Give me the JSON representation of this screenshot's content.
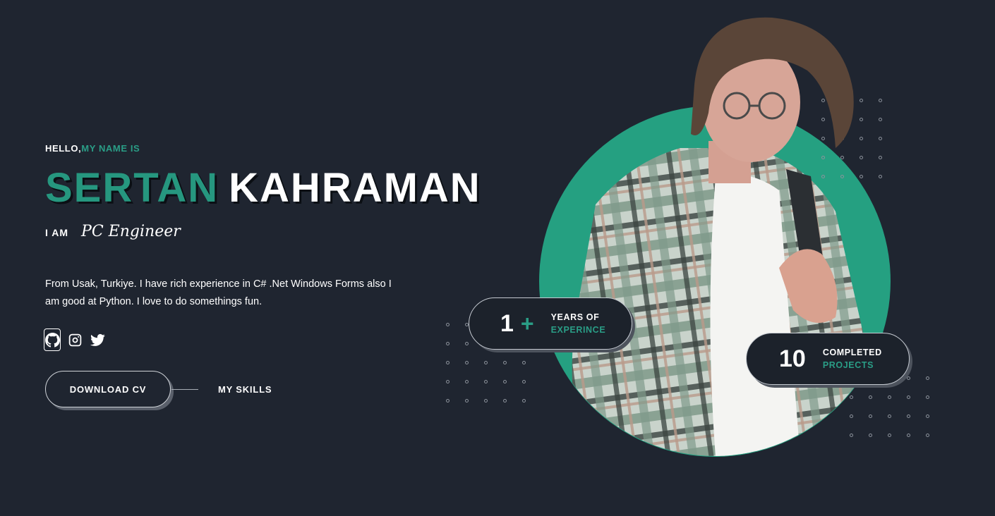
{
  "hero": {
    "greeting_hello": "HELLO,",
    "greeting_name": "MY NAME IS",
    "first_name": "SERTAN",
    "last_name": "KAHRAMAN",
    "iam_label": "I AM",
    "role": "PC Engineer",
    "bio": "From Usak, Turkiye. I have rich experience in C# .Net Windows Forms also I am good at Python. I love to do somethings fun."
  },
  "socials": [
    {
      "icon": "github-icon"
    },
    {
      "icon": "instagram-icon"
    },
    {
      "icon": "twitter-icon"
    }
  ],
  "buttons": {
    "download_cv": "DOWNLOAD CV",
    "my_skills": "MY SKILLS"
  },
  "stats": {
    "experience": {
      "value": "1",
      "suffix": "+",
      "line1": "YEARS OF",
      "line2": "EXPERINCE"
    },
    "projects": {
      "value": "10",
      "line1": "COMPLETED",
      "line2": "PROJECTS"
    }
  },
  "colors": {
    "background": "#1f2530",
    "accent": "#26977f",
    "circle": "#25a081",
    "text": "#ffffff"
  }
}
